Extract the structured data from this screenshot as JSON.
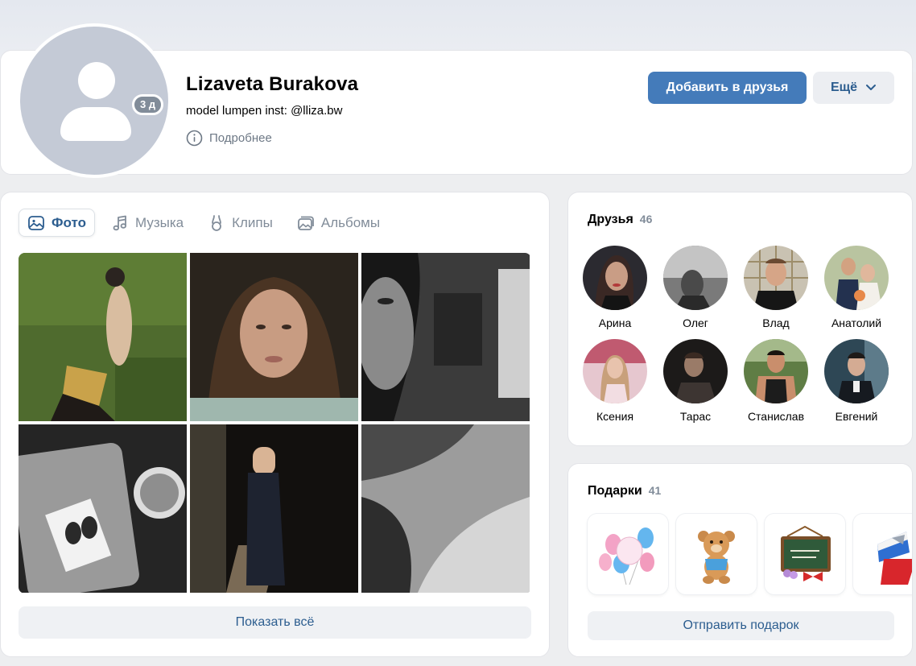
{
  "profile": {
    "name": "Lizaveta Burakova",
    "status": "model lumpen inst: @lliza.bw",
    "last_seen": "3 д",
    "more_info": "Подробнее",
    "add_friend": "Добавить в друзья",
    "more": "Ещё"
  },
  "media": {
    "tabs": [
      {
        "label": "Фото",
        "icon": "image-icon",
        "active": true
      },
      {
        "label": "Музыка",
        "icon": "music-note-icon",
        "active": false
      },
      {
        "label": "Клипы",
        "icon": "clips-icon",
        "active": false
      },
      {
        "label": "Альбомы",
        "icon": "albums-icon",
        "active": false
      }
    ],
    "show_all": "Показать всё"
  },
  "friends": {
    "title": "Друзья",
    "count": "46",
    "items": [
      {
        "name": "Арина"
      },
      {
        "name": "Олег"
      },
      {
        "name": "Влад"
      },
      {
        "name": "Анатолий"
      },
      {
        "name": "Ксения"
      },
      {
        "name": "Тарас"
      },
      {
        "name": "Станислав"
      },
      {
        "name": "Евгений"
      }
    ]
  },
  "gifts": {
    "title": "Подарки",
    "count": "41",
    "items": [
      {
        "icon": "balloons-gift-icon"
      },
      {
        "icon": "teddy-bear-gift-icon"
      },
      {
        "icon": "chalkboard-gift-icon"
      },
      {
        "icon": "flag-gift-icon"
      }
    ],
    "send": "Отправить подарок"
  },
  "colors": {
    "accent": "#447bba",
    "link": "#2c5d8f",
    "muted": "#818c99",
    "background": "#edeef0"
  }
}
